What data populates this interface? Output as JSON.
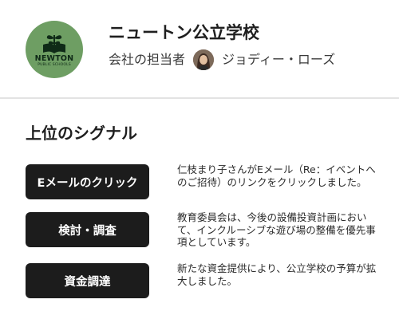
{
  "org": {
    "logo": {
      "icon": "open-book-plant-icon",
      "name": "NEWTON",
      "sub": "PUBLIC SCHOOLS",
      "bg_color": "#6e9e63"
    },
    "name": "ニュートン公立学校",
    "owner_label": "会社の担当者",
    "owner_name": "ジョディー・ローズ"
  },
  "signals": {
    "title": "上位のシグナル",
    "items": [
      {
        "label": "Eメールのクリック",
        "description": "仁枝まり子さんがEメール（Re：イベントへのご招待）のリンクをクリックしました。"
      },
      {
        "label": "検討・調査",
        "description": "教育委員会は、今後の設備投資計画において、インクルーシブな遊び場の整備を優先事項としています。"
      },
      {
        "label": "資金調達",
        "description": "新たな資金提供により、公立学校の予算が拡大しました。"
      }
    ]
  },
  "colors": {
    "button_bg": "#1c1c1c",
    "divider": "#e3e3e3"
  }
}
